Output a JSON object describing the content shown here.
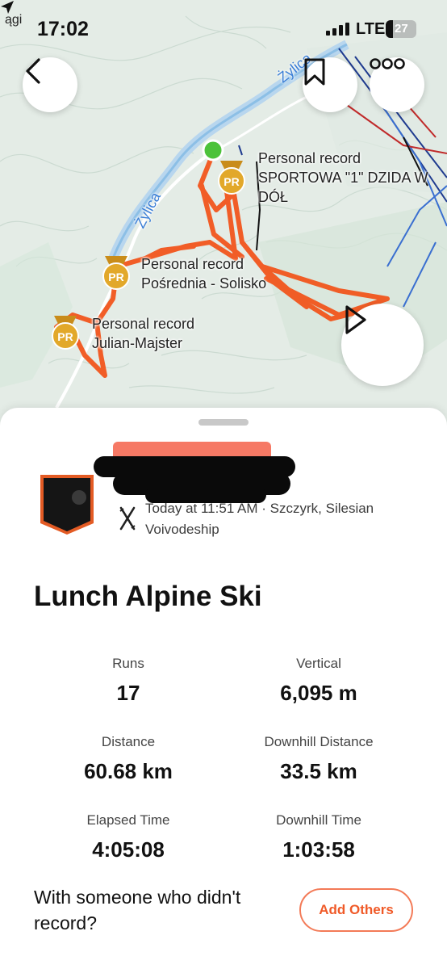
{
  "status_bar": {
    "prev_app": "ągi",
    "time": "17:02",
    "network": "LTE",
    "battery": "27"
  },
  "map": {
    "river_labels": [
      "Żylica",
      "Żylica"
    ],
    "personal_records": [
      {
        "tag": "Personal record",
        "segment": "SPORTOWA \"1\" DZIDA W DÓŁ"
      },
      {
        "tag": "Personal record",
        "segment": "Pośrednia - Solisko"
      },
      {
        "tag": "Personal record",
        "segment": "Julian-Majster"
      }
    ],
    "badge_text": "PR",
    "icons": {
      "back": "chevron-left-icon",
      "bookmark": "bookmark-icon",
      "more": "more-dots-icon",
      "play": "play-icon"
    },
    "colors": {
      "track": "#f2561d",
      "start": "#4cc23a",
      "badge": "#e2a82a"
    }
  },
  "activity": {
    "meta": "Today at 11:51 AM · Szczyrk, Silesian Voivodeship",
    "title": "Lunch Alpine Ski",
    "stats": [
      {
        "label": "Runs",
        "value": "17"
      },
      {
        "label": "Vertical",
        "value": "6,095 m"
      },
      {
        "label": "Distance",
        "value": "60.68 km"
      },
      {
        "label": "Downhill Distance",
        "value": "33.5 km"
      },
      {
        "label": "Elapsed Time",
        "value": "4:05:08"
      },
      {
        "label": "Downhill Time",
        "value": "1:03:58"
      }
    ]
  },
  "footer": {
    "prompt": "With someone who didn't record?",
    "button": "Add Others"
  },
  "colors": {
    "accent": "#f05a28"
  }
}
